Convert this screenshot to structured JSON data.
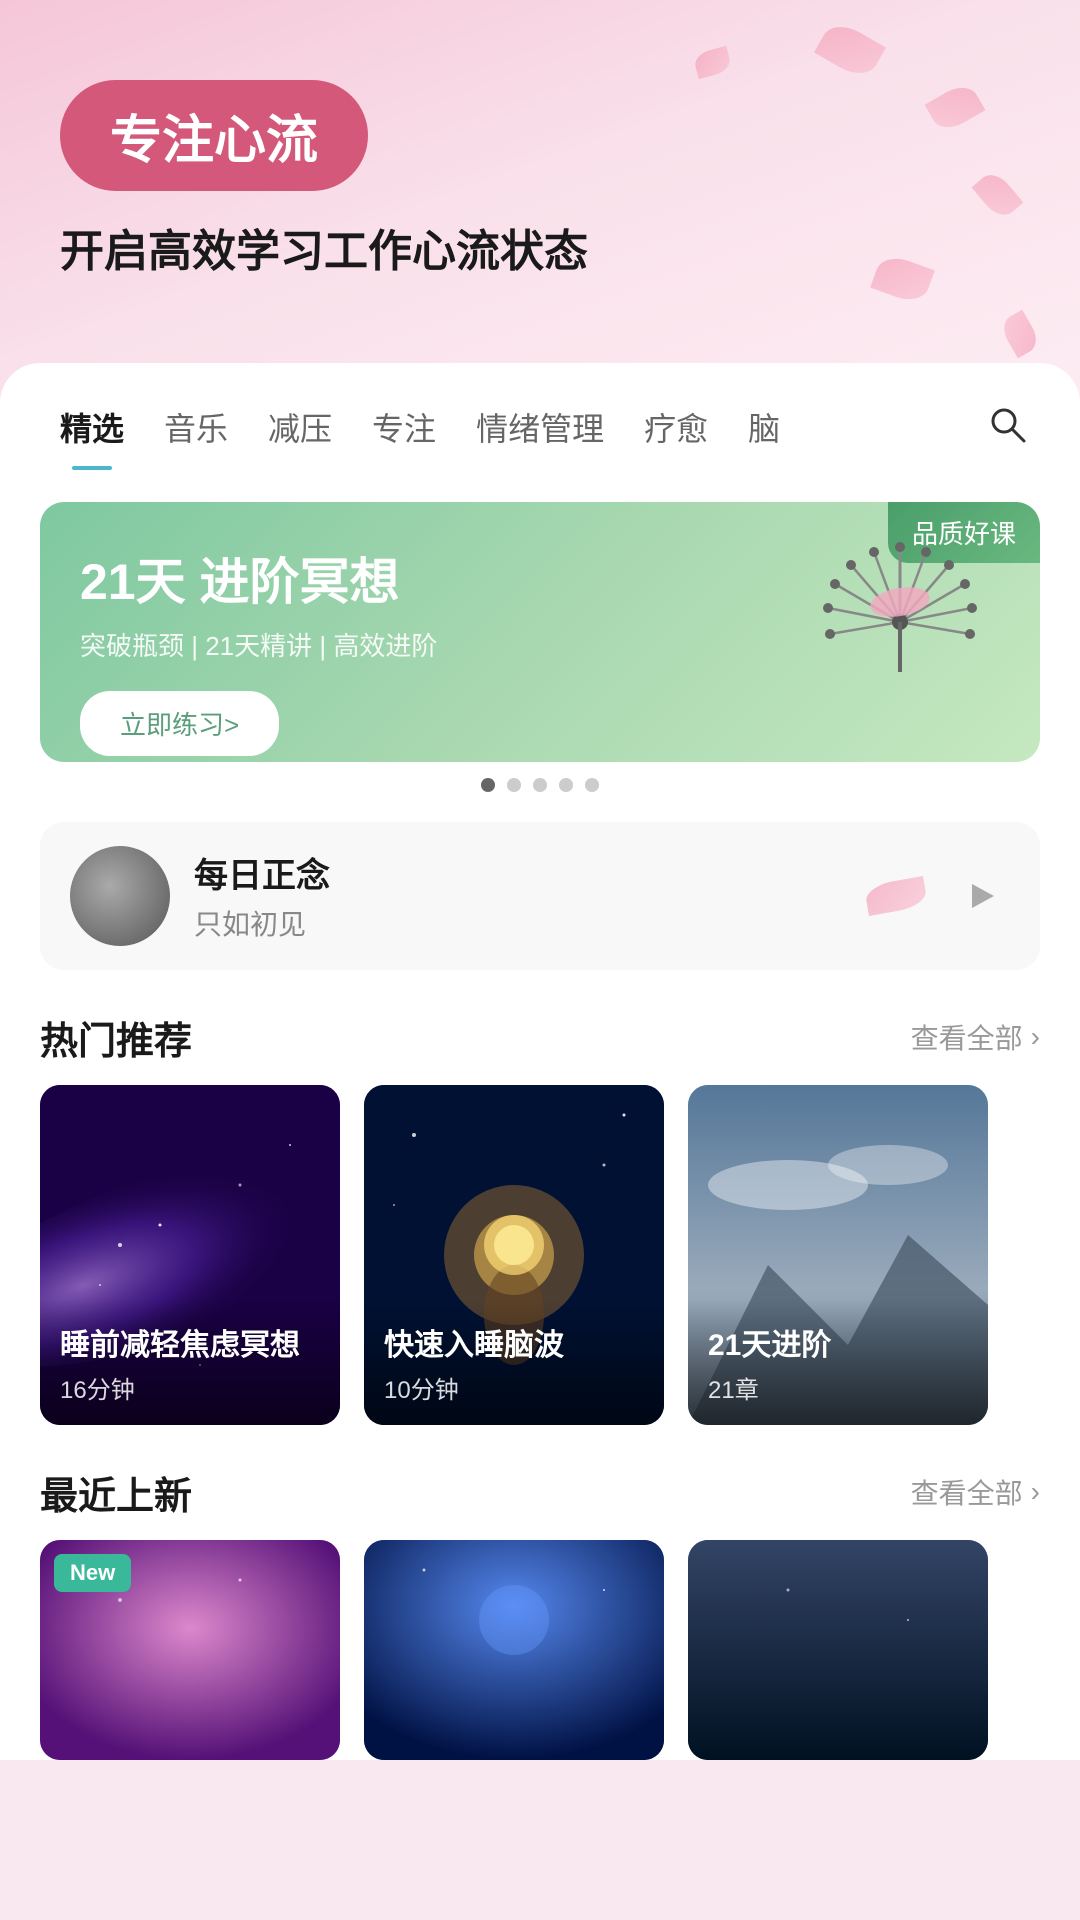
{
  "hero": {
    "badge": "专注心流",
    "subtitle": "开启高效学习工作心流状态"
  },
  "tabs": {
    "items": [
      {
        "label": "精选",
        "active": true
      },
      {
        "label": "音乐",
        "active": false
      },
      {
        "label": "减压",
        "active": false
      },
      {
        "label": "专注",
        "active": false
      },
      {
        "label": "情绪管理",
        "active": false
      },
      {
        "label": "疗愈",
        "active": false
      },
      {
        "label": "脑",
        "active": false
      }
    ]
  },
  "banner": {
    "quality_tag": "品质好课",
    "title": "21天 进阶冥想",
    "desc": "突破瓶颈 | 21天精讲 | 高效进阶",
    "btn_label": "立即练习>",
    "dots": [
      true,
      false,
      false,
      false,
      false
    ]
  },
  "daily": {
    "title": "每日正念",
    "subtitle": "只如初见",
    "play_icon": "▷"
  },
  "hot_section": {
    "title": "热门推荐",
    "more_label": "查看全部",
    "cards": [
      {
        "name": "睡前减轻焦虑冥想",
        "duration": "16分钟"
      },
      {
        "name": "快速入睡脑波",
        "duration": "10分钟"
      },
      {
        "name": "21天进阶",
        "duration": "21章"
      }
    ]
  },
  "new_section": {
    "title": "最近上新",
    "more_label": "查看全部",
    "new_badge": "New",
    "cards": [
      {
        "has_new": true
      },
      {
        "has_new": false
      },
      {
        "has_new": false
      }
    ]
  }
}
